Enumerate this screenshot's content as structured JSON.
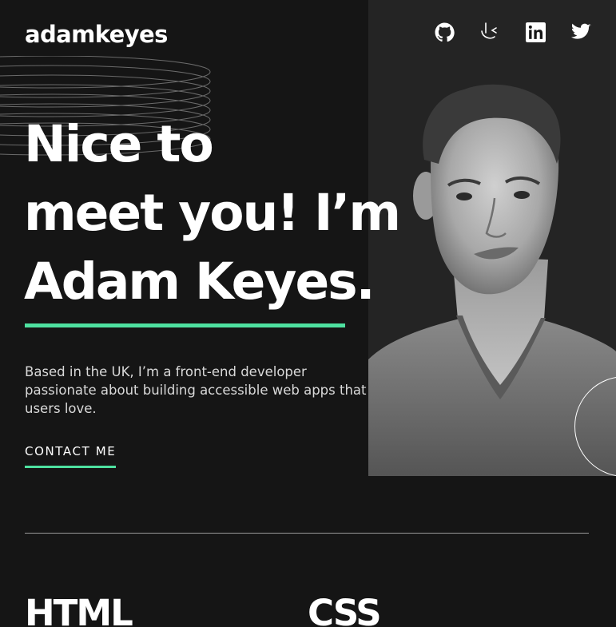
{
  "header": {
    "logo": "adamkeyes",
    "socials": [
      {
        "name": "github",
        "icon": "github-icon"
      },
      {
        "name": "frontend-mentor",
        "icon": "frontend-mentor-icon"
      },
      {
        "name": "linkedin",
        "icon": "linkedin-icon"
      },
      {
        "name": "twitter",
        "icon": "twitter-icon"
      }
    ]
  },
  "hero": {
    "headline_line1": "Nice to",
    "headline_line2": "meet you! I’m",
    "headline_line3": "Adam Keyes.",
    "intro": "Based in the UK, I’m a front-end developer passionate about building accessible web apps that users love.",
    "contact_label": "CONTACT ME",
    "accent_color": "#4ee1a0"
  },
  "skills": [
    {
      "title": "HTML"
    },
    {
      "title": "CSS"
    }
  ]
}
